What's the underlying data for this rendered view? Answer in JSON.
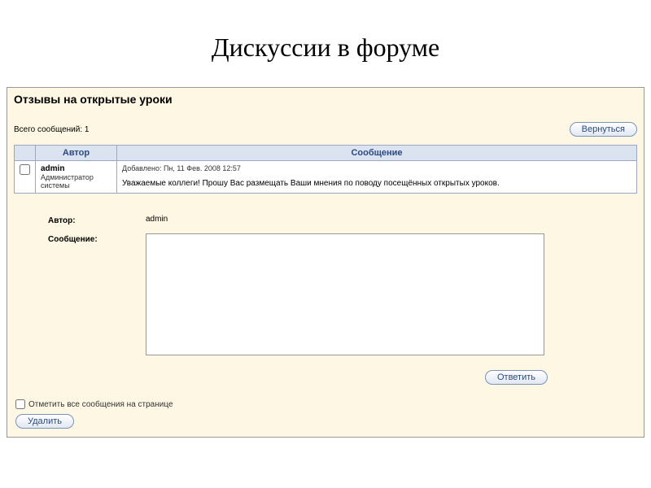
{
  "page_title": "Дискуссии в форуме",
  "panel": {
    "header": "Отзывы на открытые уроки",
    "msg_count": "Всего сообщений: 1",
    "back_btn": "Вернуться"
  },
  "table": {
    "col_author": "Автор",
    "col_message": "Сообщение",
    "rows": [
      {
        "author_name": "admin",
        "author_role": "Администратор системы",
        "date": "Добавлено: Пн, 11 Фев. 2008 12:57",
        "body": "Уважаемые коллеги! Прошу Вас размещать Ваши мнения по поводу посещённых открытых уроков."
      }
    ]
  },
  "form": {
    "author_label": "Автор:",
    "author_value": "admin",
    "message_label": "Сообщение:",
    "reply_btn": "Ответить"
  },
  "footer": {
    "mark_all": "Отметить все сообщения на странице",
    "delete_btn": "Удалить"
  }
}
